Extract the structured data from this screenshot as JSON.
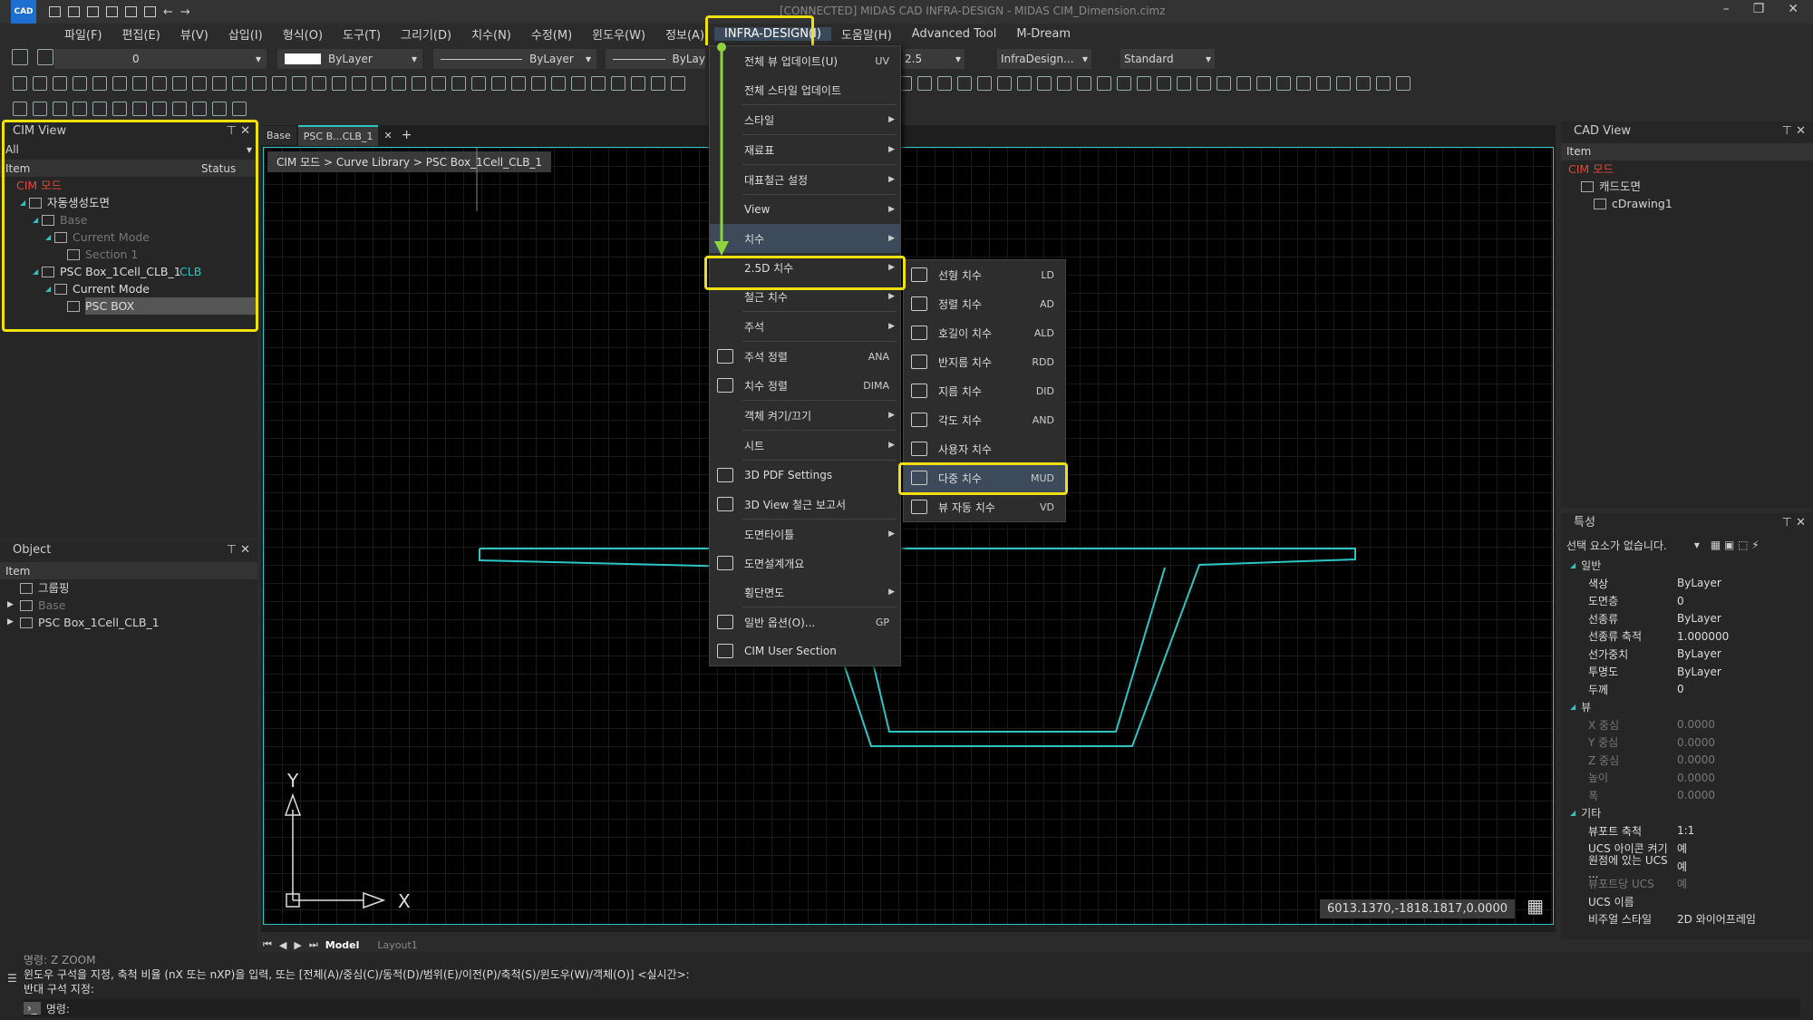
{
  "app": {
    "badge": "CAD",
    "title": "[CONNECTED] MIDAS CAD INFRA-DESIGN - MIDAS CIM_Dimension.cimz"
  },
  "menubar": [
    "파일(F)",
    "편집(E)",
    "뷰(V)",
    "삽입(I)",
    "형식(O)",
    "도구(T)",
    "그리기(D)",
    "치수(N)",
    "수정(M)",
    "윈도우(W)",
    "정보(A)",
    "INFRA-DESIGN(I)",
    "도움말(H)",
    "Advanced Tool",
    "M-Dream"
  ],
  "toolbar": {
    "layer": "0",
    "color": "ByLayer",
    "linetype": "ByLayer",
    "lineweight": "ByLay",
    "dimscale": "2.5",
    "dimstyle": "InfraDesign...",
    "textstyle": "Standard"
  },
  "cim_view": {
    "title": "CIM View",
    "filter": "All",
    "col_item": "Item",
    "col_status": "Status",
    "tree": [
      {
        "label": "CIM 모드",
        "indent": 0,
        "style": "red"
      },
      {
        "label": "자동생성도면",
        "indent": 1,
        "style": "normal"
      },
      {
        "label": "Base",
        "indent": 2,
        "style": "dim"
      },
      {
        "label": "Current Mode",
        "indent": 3,
        "style": "dim"
      },
      {
        "label": "Section 1",
        "indent": 4,
        "style": "dim"
      },
      {
        "label": "PSC Box_1Cell_CLB_1",
        "indent": 2,
        "style": "normal",
        "status": "CLB"
      },
      {
        "label": "Current Mode",
        "indent": 3,
        "style": "normal"
      },
      {
        "label": "PSC BOX",
        "indent": 4,
        "style": "selected"
      }
    ]
  },
  "object_panel": {
    "title": "Object",
    "col_item": "Item",
    "items": [
      "그룹핑",
      "Base",
      "PSC Box_1Cell_CLB_1"
    ]
  },
  "tabs": [
    "Base",
    "PSC B...CLB_1"
  ],
  "breadcrumb": "CIM 모드 > Curve Library > PSC Box_1Cell_CLB_1",
  "infra_menu": [
    {
      "label": "전체 뷰 업데이트(U)",
      "sc": "UV"
    },
    {
      "label": "전체 스타일 업데이트"
    },
    {
      "sep": true
    },
    {
      "label": "스타일",
      "sub": true
    },
    {
      "sep": true
    },
    {
      "label": "재료표",
      "sub": true
    },
    {
      "sep": true
    },
    {
      "label": "대표철근 설정",
      "sub": true
    },
    {
      "sep": true
    },
    {
      "label": "View",
      "sub": true
    },
    {
      "label": "치수",
      "sub": true,
      "hl": true
    },
    {
      "label": "2.5D 치수",
      "sub": true
    },
    {
      "label": "철근 치수",
      "sub": true
    },
    {
      "sep": true
    },
    {
      "label": "주석",
      "sub": true
    },
    {
      "sep": true
    },
    {
      "label": "주석 정렬",
      "sc": "ANA",
      "icon": true
    },
    {
      "label": "치수 정렬",
      "sc": "DIMA",
      "icon": true
    },
    {
      "sep": true
    },
    {
      "label": "객체 켜기/끄기",
      "sub": true
    },
    {
      "sep": true
    },
    {
      "label": "시트",
      "sub": true
    },
    {
      "sep": true
    },
    {
      "label": "3D PDF Settings",
      "icon": true
    },
    {
      "label": "3D View 철근 보고서",
      "icon": true
    },
    {
      "sep": true
    },
    {
      "label": "도면타이틀",
      "sub": true
    },
    {
      "label": "도면설계개요",
      "icon": true
    },
    {
      "label": "횡단면도",
      "sub": true
    },
    {
      "sep": true
    },
    {
      "label": "일반 옵션(O)...",
      "sc": "GP",
      "icon": true
    },
    {
      "label": "CIM User Section",
      "icon": true
    }
  ],
  "dim_menu": [
    {
      "label": "선형 치수",
      "sc": "LD"
    },
    {
      "label": "정렬 치수",
      "sc": "AD"
    },
    {
      "label": "호길이 치수",
      "sc": "ALD"
    },
    {
      "label": "반지름 치수",
      "sc": "RDD"
    },
    {
      "label": "지름 치수",
      "sc": "DID"
    },
    {
      "label": "각도 치수",
      "sc": "AND"
    },
    {
      "label": "사용자 치수",
      "sc": ""
    },
    {
      "label": "다중 치수",
      "sc": "MUD",
      "hl": true
    },
    {
      "label": "뷰 자동 치수",
      "sc": "VD"
    }
  ],
  "cad_view": {
    "title": "CAD View",
    "col_item": "Item",
    "tree": [
      "CIM 모드",
      "캐드도면",
      "cDrawing1"
    ]
  },
  "properties": {
    "title": "특성",
    "select_text": "선택 요소가 없습니다.",
    "sections": [
      {
        "name": "일반",
        "rows": [
          [
            "색상",
            "ByLayer"
          ],
          [
            "도면층",
            "0"
          ],
          [
            "선종류",
            "ByLayer"
          ],
          [
            "선종류 축적",
            "1.000000"
          ],
          [
            "선가중치",
            "ByLayer"
          ],
          [
            "투명도",
            "ByLayer"
          ],
          [
            "두께",
            "0"
          ]
        ]
      },
      {
        "name": "뷰",
        "rows": [
          [
            "X 중심",
            "0.0000"
          ],
          [
            "Y 중심",
            "0.0000"
          ],
          [
            "Z 중심",
            "0.0000"
          ],
          [
            "높이",
            "0.0000"
          ],
          [
            "폭",
            "0.0000"
          ]
        ]
      },
      {
        "name": "기타",
        "rows": [
          [
            "뷰포트 축척",
            "1:1"
          ],
          [
            "UCS 아이콘 켜기",
            "예"
          ],
          [
            "원점에 있는 UCS ...",
            "예"
          ],
          [
            "뷰포트당 UCS",
            "예"
          ],
          [
            "UCS 이름",
            ""
          ],
          [
            "비주얼 스타일",
            "2D 와이어프레임"
          ]
        ]
      }
    ]
  },
  "canvas": {
    "coords": "6013.1370,-1818.1817,0.0000",
    "axis_x": "X",
    "axis_y": "Y"
  },
  "layout_tabs": [
    "Model",
    "Layout1"
  ],
  "command": {
    "line1": "명령: Z ZOOM",
    "line2": "윈도우 구석을 지정, 축척 비율 (nX 또는 nXP)을 입력, 또는 [전체(A)/중심(C)/동적(D)/범위(E)/이전(P)/축척(S)/윈도우(W)/객체(O)] <실시간>:",
    "line3": "반대 구석 지정:",
    "prompt": "명령:"
  },
  "colors": {
    "accent": "#2ec4c4",
    "highlight": "#f0e010",
    "red": "#e0483a",
    "green_arrow": "#8fd43c"
  }
}
